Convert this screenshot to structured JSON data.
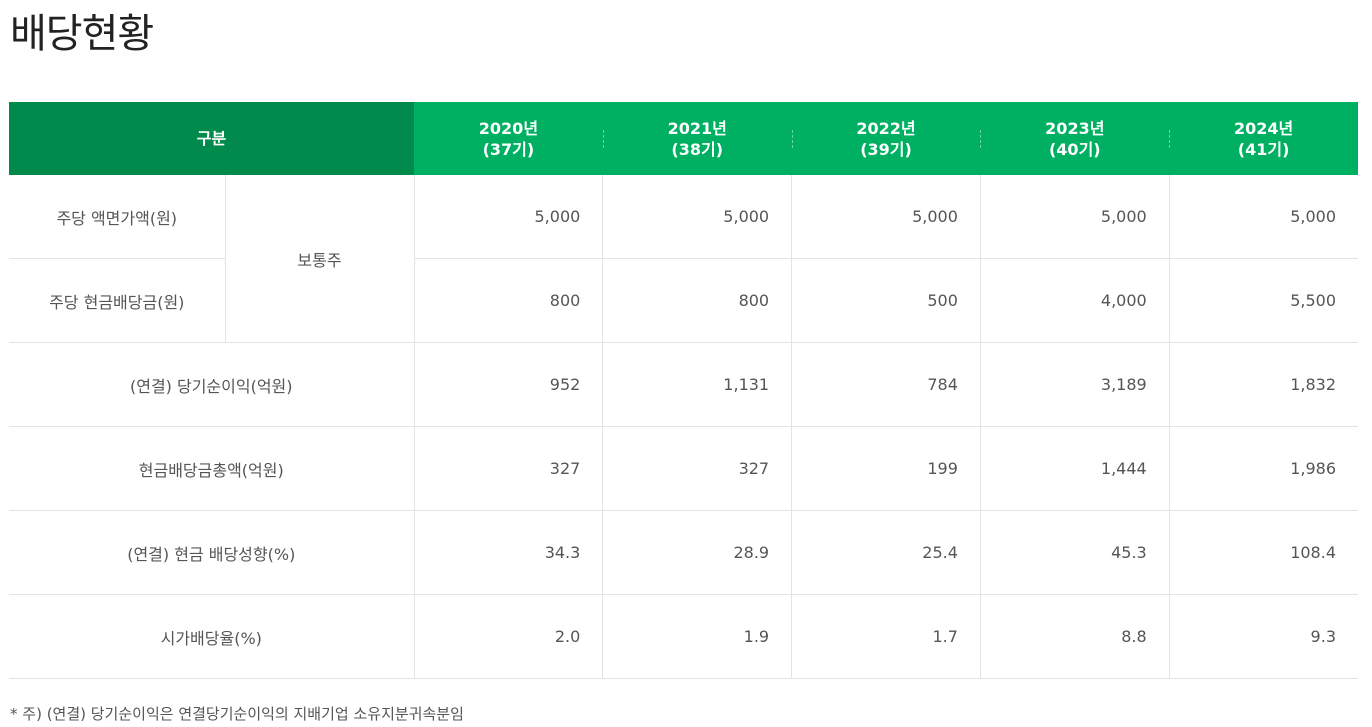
{
  "title": "배당현황",
  "table": {
    "header": {
      "category": "구분",
      "years": [
        {
          "year": "2020년",
          "period": "(37기)"
        },
        {
          "year": "2021년",
          "period": "(38기)"
        },
        {
          "year": "2022년",
          "period": "(39기)"
        },
        {
          "year": "2023년",
          "period": "(40기)"
        },
        {
          "year": "2024년",
          "period": "(41기)"
        }
      ]
    },
    "share_type": "보통주",
    "rows": [
      {
        "label": "주당 액면가액(원)",
        "values": [
          "5,000",
          "5,000",
          "5,000",
          "5,000",
          "5,000"
        ]
      },
      {
        "label": "주당 현금배당금(원)",
        "values": [
          "800",
          "800",
          "500",
          "4,000",
          "5,500"
        ]
      },
      {
        "label": "(연결) 당기순이익(억원)",
        "values": [
          "952",
          "1,131",
          "784",
          "3,189",
          "1,832"
        ]
      },
      {
        "label": "현금배당금총액(억원)",
        "values": [
          "327",
          "327",
          "199",
          "1,444",
          "1,986"
        ]
      },
      {
        "label": "(연결) 현금 배당성향(%)",
        "values": [
          "34.3",
          "28.9",
          "25.4",
          "45.3",
          "108.4"
        ]
      },
      {
        "label": "시가배당율(%)",
        "values": [
          "2.0",
          "1.9",
          "1.7",
          "8.8",
          "9.3"
        ]
      }
    ]
  },
  "footnote": "* 주) (연결) 당기순이익은 연결당기순이익의 지배기업 소유지분귀속분임",
  "colors": {
    "header_category": "#008a4c",
    "header_years": "#00b062",
    "border": "#e3e3e3"
  }
}
